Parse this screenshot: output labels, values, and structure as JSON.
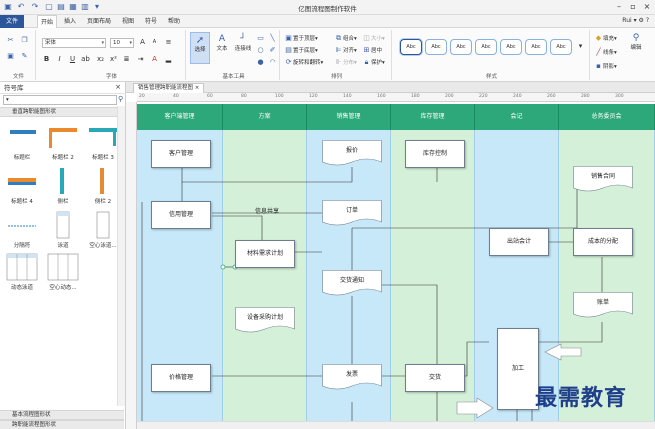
{
  "window": {
    "title": "亿图流程图制作软件",
    "user": "Rui"
  },
  "menu": [
    "文件",
    "开始",
    "插入",
    "页面布局",
    "视图",
    "符号",
    "帮助"
  ],
  "ribbon": {
    "groups": [
      "文件",
      "字体",
      "基本工具",
      "排列",
      "样式"
    ],
    "font_name": "宋体",
    "font_size": "10",
    "tools": [
      "选择",
      "文本",
      "连接线"
    ],
    "arrange": [
      "置于顶层",
      "置于底层",
      "旋转和翻转",
      "组合",
      "对齐",
      "分布",
      "大小",
      "居中",
      "保护"
    ],
    "style_swatch": "Abc",
    "right": [
      "填充",
      "线条",
      "阴影",
      "编辑"
    ]
  },
  "sidebar": {
    "title": "符号库",
    "category_top": "垂直跨职能图形状",
    "symbols": [
      "标题栏",
      "标题栏 2",
      "标题栏 3",
      "标题栏 4",
      "侧栏",
      "侧栏 2",
      "分隔符",
      "泳道",
      "空心泳道...",
      "动态泳道",
      "空心动态..."
    ],
    "category_bottom": "基本流程图形状",
    "category_bottom2": "跨职能流程图形状"
  },
  "doc_tab": "销售管理跨职能流程图",
  "ruler_marks": [
    "20",
    "40",
    "60",
    "80",
    "100",
    "120",
    "140",
    "160",
    "180",
    "200",
    "220",
    "240",
    "260",
    "280",
    "300"
  ],
  "lanes": [
    "客户端管理",
    "方案",
    "销售管理",
    "库存管理",
    "会记",
    "总务委员会"
  ],
  "nodes": {
    "customer_mgmt": "客户管理",
    "credit_mgmt": "信用管理",
    "price_mgmt": "价格管理",
    "material_plan": "材料需求计划",
    "equip_plan": "设备采购计划",
    "report": "报价",
    "order": "订单",
    "trade_notice": "交货通知",
    "ship": "发票",
    "stock_ctrl": "库存控制",
    "deliver": "交货",
    "outsource": "出站会计",
    "sales_contract": "销售合同",
    "cost_alloc": "成本的分配",
    "ledger": "账单",
    "process": "加工",
    "info_share": "信息共享"
  },
  "watermark": "最需教育"
}
